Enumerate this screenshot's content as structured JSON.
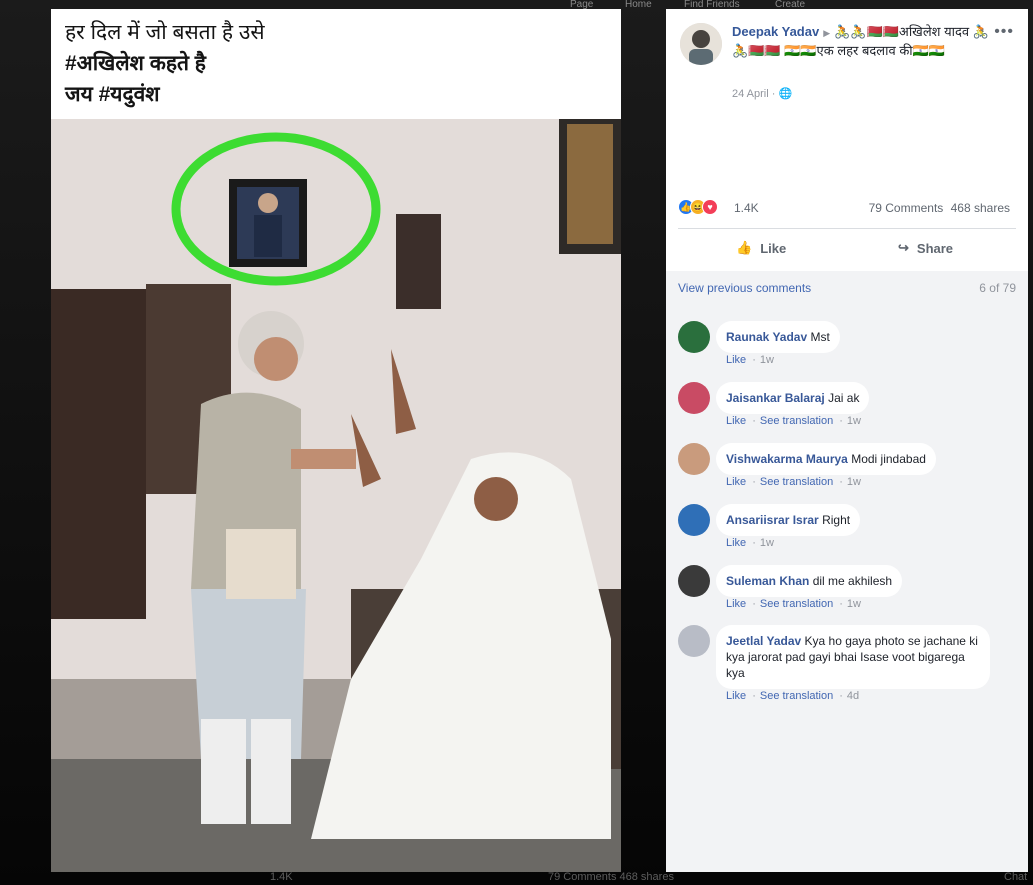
{
  "background": {
    "nav_items": [
      "Page",
      "Home",
      "Find Friends",
      "Create"
    ],
    "bottom_left": "1.4K",
    "bottom_right": "79 Comments  468 shares",
    "chat_label": "Chat"
  },
  "photo": {
    "caption_lines": [
      "हर दिल में जो बसता है उसे",
      "#अखिलेश कहते है",
      "जय #यदुवंश"
    ]
  },
  "post": {
    "author": "Deepak Yadav",
    "title_text": "🚴🚴🇧🇾🇧🇾अखिलेश यादव 🚴🚴🇧🇾🇧🇾 🇮🇳🇮🇳एक लहर बदलाव की🇮🇳🇮🇳",
    "date": "24 April",
    "reaction_count": "1.4K",
    "comment_count": "79 Comments",
    "share_count": "468 shares",
    "like_label": "Like",
    "share_label": "Share",
    "view_previous": "View previous comments",
    "comment_position": "6 of 79",
    "colors": {
      "link": "#4267b2",
      "name": "#385898",
      "muted": "#90949c"
    }
  },
  "comments": [
    {
      "name": "Raunak Yadav",
      "text": "Mst",
      "like": "Like",
      "translate": "",
      "time": "1w"
    },
    {
      "name": "Jaisankar Balaraj",
      "text": "Jai ak",
      "like": "Like",
      "translate": "See translation",
      "time": "1w"
    },
    {
      "name": "Vishwakarma Maurya",
      "text": "Modi jindabad",
      "like": "Like",
      "translate": "See translation",
      "time": "1w"
    },
    {
      "name": "Ansariisrar Israr",
      "text": "Right",
      "like": "Like",
      "translate": "",
      "time": "1w"
    },
    {
      "name": "Suleman Khan",
      "text": "dil me akhilesh",
      "like": "Like",
      "translate": "See translation",
      "time": "1w"
    },
    {
      "name": "Jeetlal Yadav",
      "text": "Kya ho gaya photo se jachane ki kya jarorat pad gayi bhai Isase voot bigarega kya",
      "like": "Like",
      "translate": "See translation",
      "time": "4d"
    }
  ]
}
